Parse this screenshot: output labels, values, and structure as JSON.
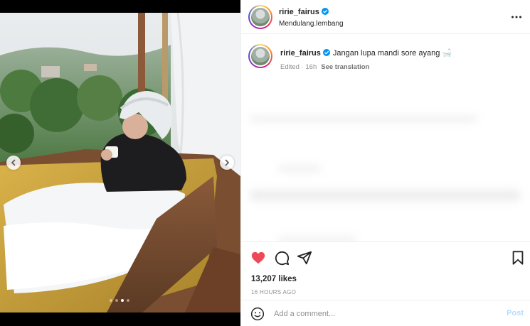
{
  "post": {
    "username": "ririe_fairus",
    "location": "Mendulang.lembang",
    "caption": "Jangan lupa mandi sore ayang 🛁",
    "edited": "Edited",
    "age": "16h",
    "see_translation": "See translation",
    "likes": "13,207 likes",
    "time_ago": "16 HOURS AGO",
    "liked": true,
    "carousel": {
      "count": 4,
      "active_index": 2
    }
  },
  "comment": {
    "placeholder": "Add a comment...",
    "post_label": "Post"
  },
  "icons": {
    "verified": "verified-badge-icon",
    "more": "more-options-icon",
    "like": "heart-icon",
    "comment": "comment-icon",
    "share": "share-icon",
    "save": "bookmark-icon",
    "emoji": "emoji-icon",
    "prev": "chevron-left-icon",
    "next": "chevron-right-icon"
  },
  "colors": {
    "like_red": "#ed4956",
    "verified_blue": "#0095f6",
    "post_disabled": "#b3dbff"
  }
}
